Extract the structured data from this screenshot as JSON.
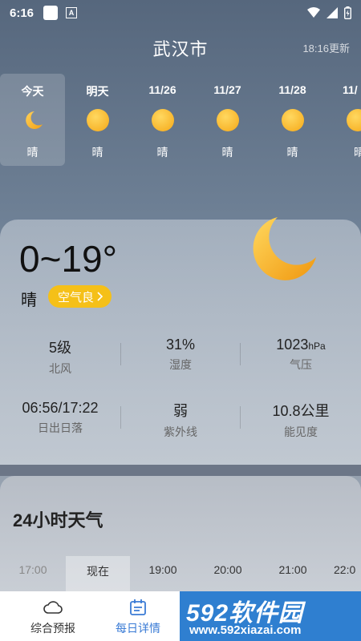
{
  "status_bar": {
    "time": "6:16",
    "a_icon": "A"
  },
  "header": {
    "city": "武汉市",
    "updated": "18:16更新"
  },
  "days": [
    {
      "label": "今天",
      "icon": "moon-icon",
      "weather": "晴",
      "active": true
    },
    {
      "label": "明天",
      "icon": "sun-icon",
      "weather": "晴"
    },
    {
      "label": "11/26",
      "icon": "sun-icon",
      "weather": "晴"
    },
    {
      "label": "11/27",
      "icon": "sun-icon",
      "weather": "晴"
    },
    {
      "label": "11/28",
      "icon": "sun-icon",
      "weather": "晴"
    },
    {
      "label": "11/",
      "icon": "sun-icon",
      "weather": "晴"
    }
  ],
  "current": {
    "temp": "0~19°",
    "condition": "晴",
    "aqi": "空气良",
    "aqi_color": "#f5c018",
    "stats": [
      {
        "value": "5级",
        "unit": "",
        "label": "北风"
      },
      {
        "value": "31%",
        "unit": "",
        "label": "湿度"
      },
      {
        "value": "1023",
        "unit": "hPa",
        "label": "气压"
      },
      {
        "value": "06:56/17:22",
        "unit": "",
        "label": "日出日落"
      },
      {
        "value": "弱",
        "unit": "",
        "label": "紫外线"
      },
      {
        "value": "10.8公里",
        "unit": "",
        "label": "能见度"
      }
    ]
  },
  "hourly": {
    "title": "24小时天气",
    "hours": [
      "17:00",
      "现在",
      "19:00",
      "20:00",
      "21:00",
      "22:0"
    ]
  },
  "bottom_nav": [
    {
      "label": "综合预报",
      "icon": "cloud-icon"
    },
    {
      "label": "每日详情",
      "icon": "calendar-icon",
      "active": true
    }
  ],
  "watermark": {
    "brand": "592软件园",
    "url": "www.592xiazai.com"
  },
  "colors": {
    "accent": "#3a7bd5",
    "sun": "#f5a818"
  }
}
